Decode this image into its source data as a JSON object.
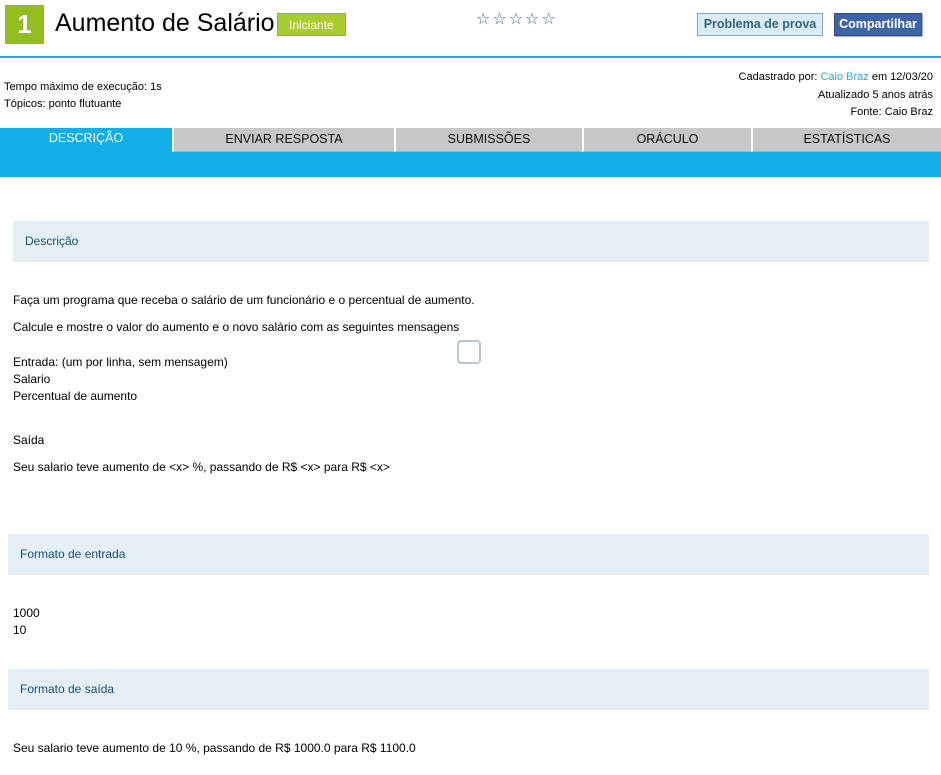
{
  "header": {
    "problem_number": "1",
    "title": "Aumento de Salário",
    "level": "Iniciante",
    "stars": "☆☆☆☆☆",
    "btn_prova": "Problema de prova",
    "btn_share": "Compartilhar"
  },
  "meta": {
    "time_limit": "Tempo máximo de execução: 1s",
    "topics": "Tópicos: ponto flutuante",
    "registered_by_prefix": "Cadastrado por:",
    "registered_by_name": "Caio Braz",
    "registered_date": "em 12/03/20",
    "updated": "Atualizado 5 anos atrás",
    "source": "Fonte: Caio Braz"
  },
  "tabs": [
    {
      "label": "DESCRIÇÃO"
    },
    {
      "label": "ENVIAR RESPOSTA"
    },
    {
      "label": "SUBMISSÕES"
    },
    {
      "label": "ORÁCULO"
    },
    {
      "label": "ESTATÍSTICAS"
    }
  ],
  "sections": {
    "description_title": "Descrição",
    "input_title": "Formato de entrada",
    "output_title": "Formato de saída"
  },
  "description": {
    "line1": "Faça um programa que receba o salário de um funcionário e o percentual de aumento.",
    "line2": "Calcule e mostre o valor do aumento e o novo salário com as seguintes mensagens",
    "line3": "Entrada: (um por linha, sem mensagem)",
    "line4": "Salario",
    "line5": "Percentual de aumento",
    "line6": "Saída",
    "line7": "Seu salario teve aumento de <x> %, passando de R$ <x> para R$ <x>"
  },
  "input_example": {
    "line1": "1000",
    "line2": "10"
  },
  "output_example": {
    "line1": "Seu salario teve aumento de 10 %, passando de R$ 1000.0 para R$ 1100.0"
  },
  "colors": {
    "accent": "#13aee5",
    "level": "#a9cc2e",
    "share": "#3f63a7"
  }
}
